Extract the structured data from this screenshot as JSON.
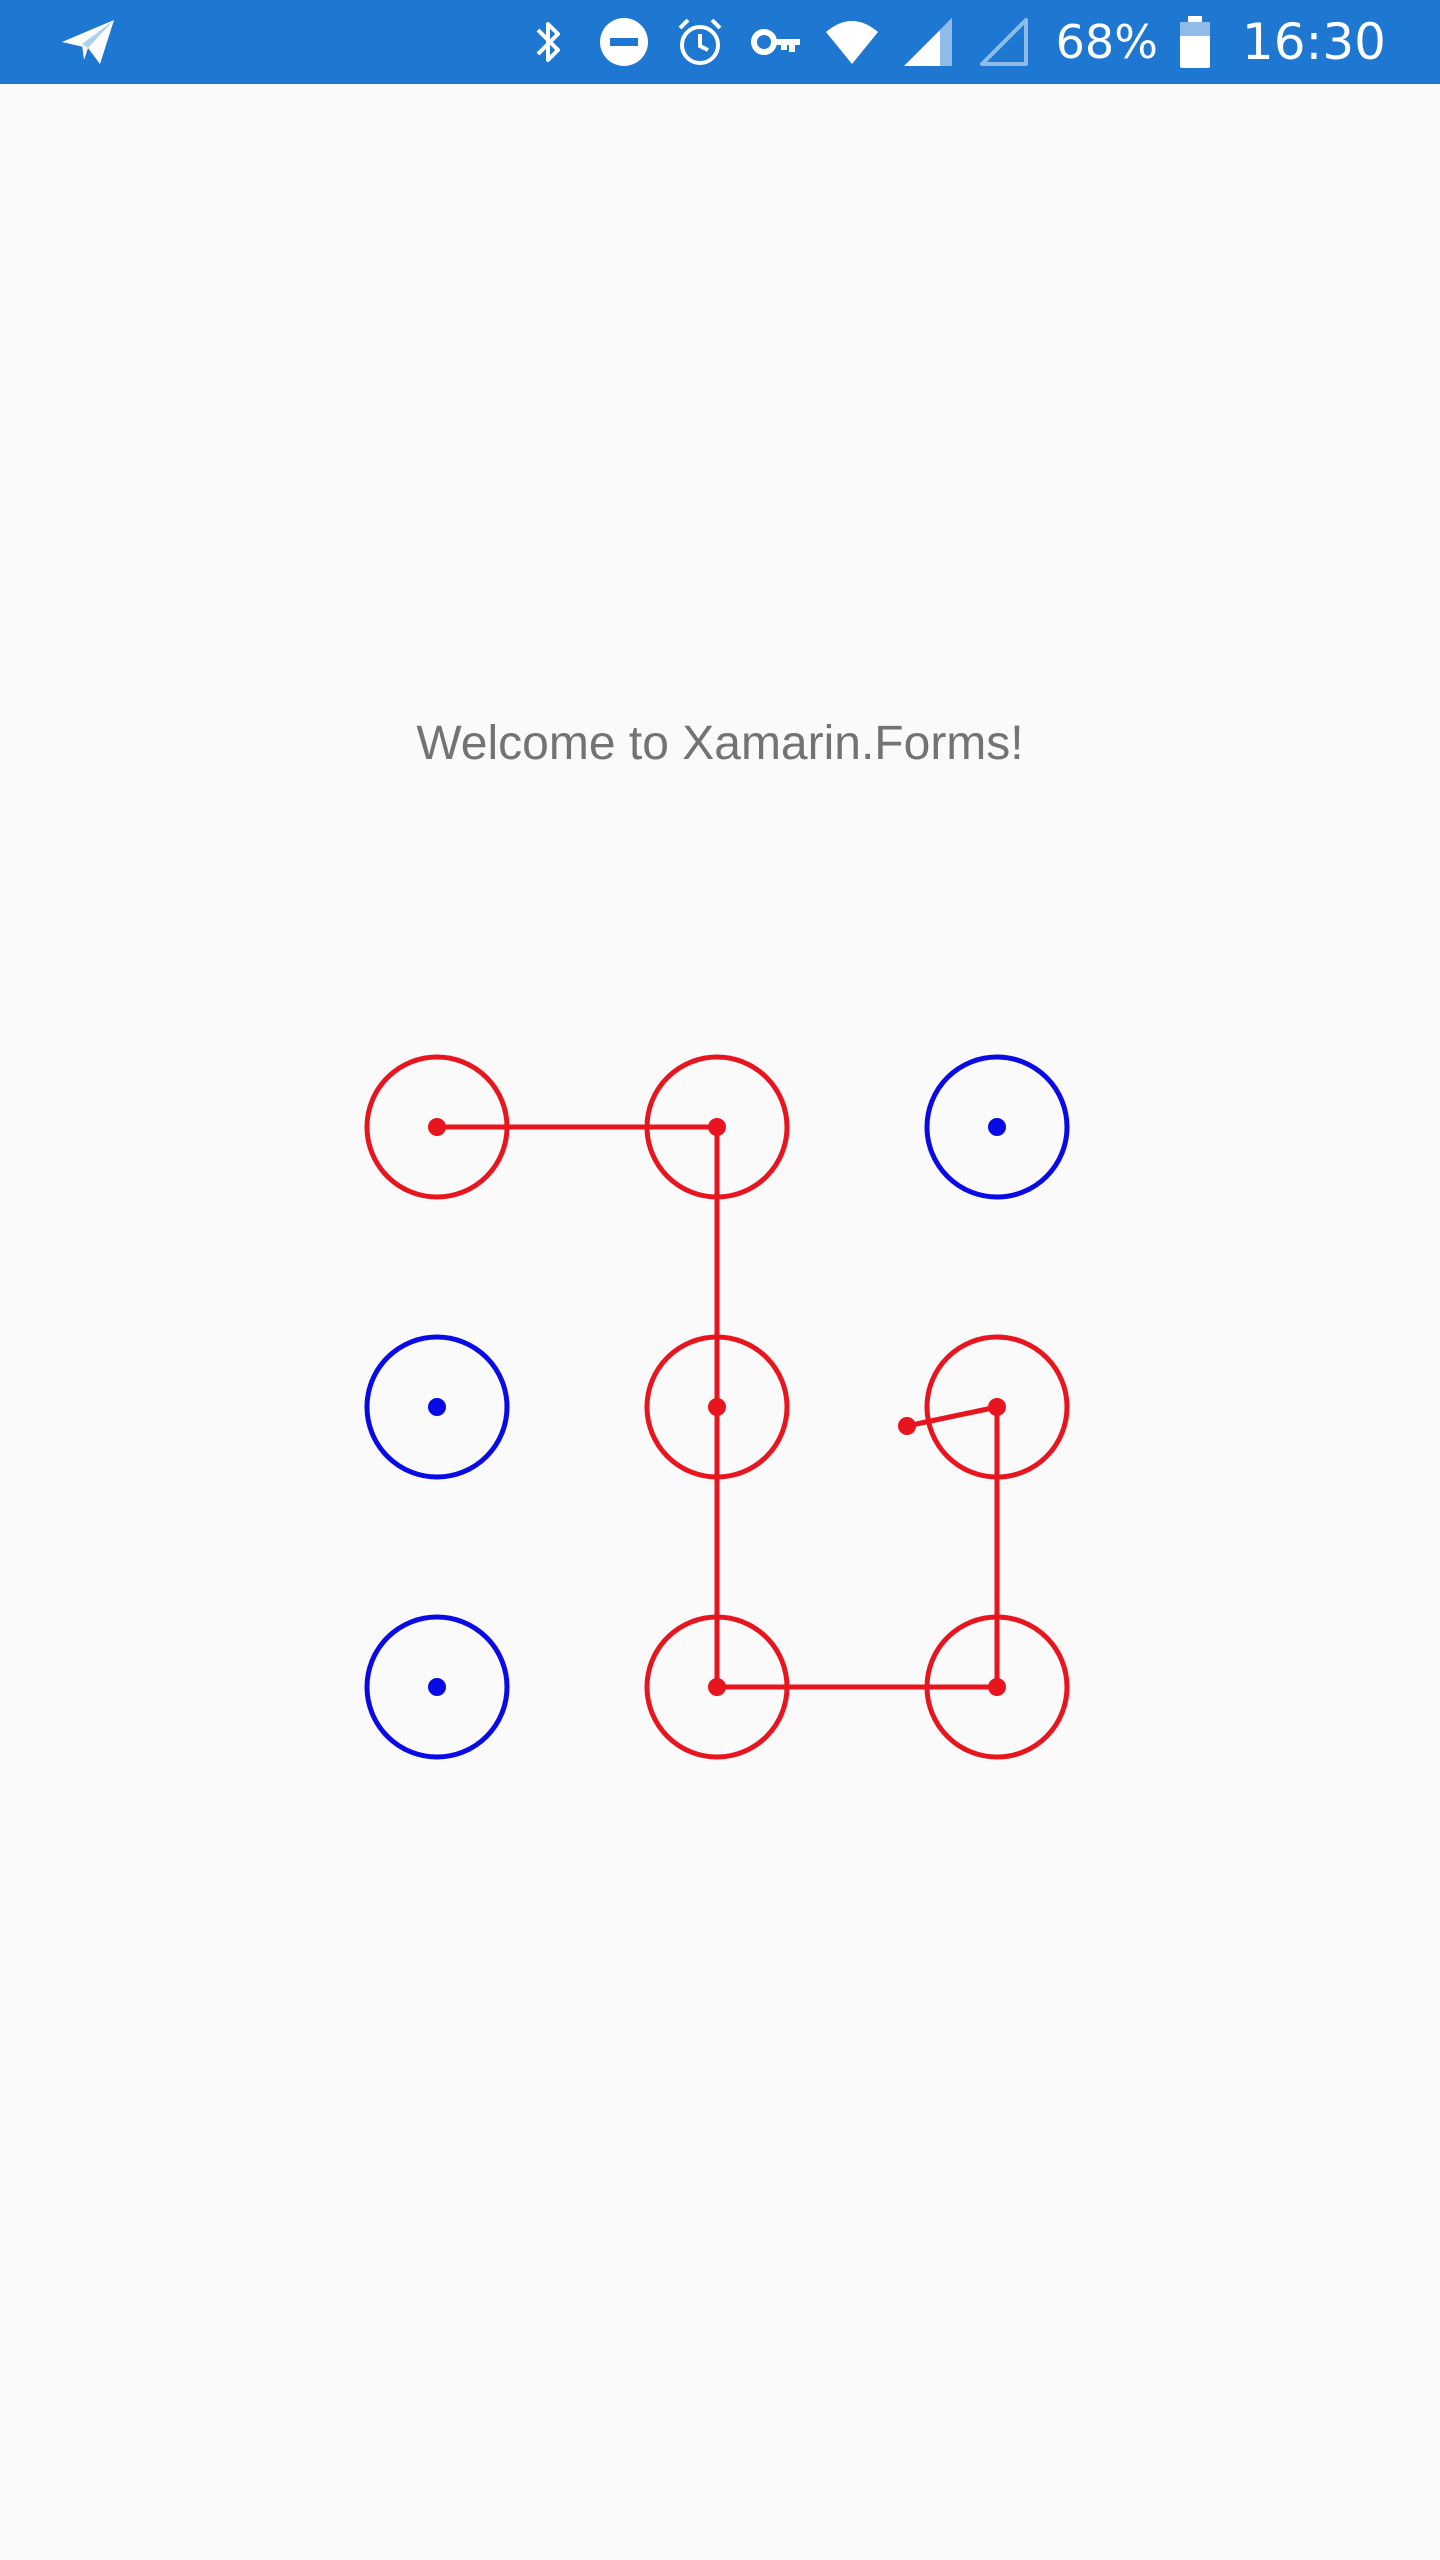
{
  "status_bar": {
    "background": "#1e78d2",
    "left_icon": "paper-plane-icon",
    "icons": [
      "bluetooth-icon",
      "do-not-disturb-icon",
      "alarm-icon",
      "vpn-key-icon",
      "wifi-icon",
      "cell-signal-icon",
      "cell-signal-empty-icon",
      "battery-icon"
    ],
    "battery_percent": "68%",
    "time": "16:30"
  },
  "main": {
    "welcome_text": "Welcome to Xamarin.Forms!"
  },
  "pattern_lock": {
    "grid": [
      3,
      3
    ],
    "active_color": "#e8141e",
    "inactive_color": "#0a0ae6",
    "nodes": [
      {
        "row": 1,
        "col": 1,
        "state": "selected"
      },
      {
        "row": 1,
        "col": 2,
        "state": "selected"
      },
      {
        "row": 1,
        "col": 3,
        "state": "idle"
      },
      {
        "row": 2,
        "col": 1,
        "state": "idle"
      },
      {
        "row": 2,
        "col": 2,
        "state": "selected"
      },
      {
        "row": 2,
        "col": 3,
        "state": "selected"
      },
      {
        "row": 3,
        "col": 1,
        "state": "idle"
      },
      {
        "row": 3,
        "col": 2,
        "state": "selected"
      },
      {
        "row": 3,
        "col": 3,
        "state": "selected"
      }
    ],
    "path": [
      [
        1,
        1
      ],
      [
        1,
        2
      ],
      [
        2,
        2
      ],
      [
        3,
        2
      ],
      [
        3,
        3
      ],
      [
        2,
        3
      ]
    ],
    "trailing_drag": true
  }
}
